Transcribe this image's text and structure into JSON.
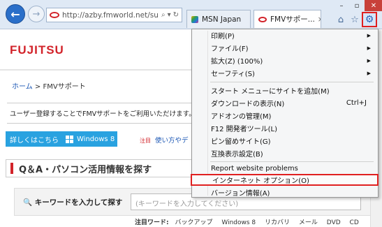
{
  "browser": {
    "address_url": "http://azby.fmworld.net/sup",
    "tabs": [
      {
        "label": "MSN Japan"
      },
      {
        "label": "FMVサポー..."
      }
    ]
  },
  "page": {
    "logo": "FUJITSU",
    "breadcrumb": {
      "home": "ホーム",
      "sep": ">",
      "current": "FMVサポート"
    },
    "notice": "ユーザー登録することでFMVサポートをご利用いただけます。今",
    "win8_banner": {
      "label": "詳しくはこちら",
      "product": "Windows 8"
    },
    "tip": {
      "tag": "注目",
      "text": "使い方やデ"
    },
    "qa_title": "Q＆A・パソコン活用情報を探す",
    "search": {
      "label": "キーワードを入力して探す",
      "placeholder": "(キーワードを入力してください)"
    },
    "keywords": {
      "label": "注目ワード:",
      "items": [
        "バックアップ",
        "Windows 8",
        "リカバリ",
        "メール",
        "DVD",
        "CD"
      ]
    }
  },
  "menu": {
    "items": [
      {
        "label": "印刷(P)",
        "submenu": true
      },
      {
        "label": "ファイル(F)",
        "submenu": true
      },
      {
        "label": "拡大(Z) (100%)",
        "submenu": true
      },
      {
        "label": "セーフティ(S)",
        "submenu": true
      },
      {
        "label": "スタート メニューにサイトを追加(M)"
      },
      {
        "label": "ダウンロードの表示(N)",
        "shortcut": "Ctrl+J"
      },
      {
        "label": "アドオンの管理(M)"
      },
      {
        "label": "F12 開発者ツール(L)"
      },
      {
        "label": "ピン留めサイト(G)"
      },
      {
        "label": "互換表示設定(B)"
      },
      {
        "label": "Report website problems"
      },
      {
        "label": "インターネット オプション(O)",
        "highlighted": true
      },
      {
        "label": "バージョン情報(A)"
      }
    ],
    "submenu_arrow": "▶"
  },
  "colors": {
    "highlight_border": "#e02020",
    "brand_red": "#d2232a"
  }
}
